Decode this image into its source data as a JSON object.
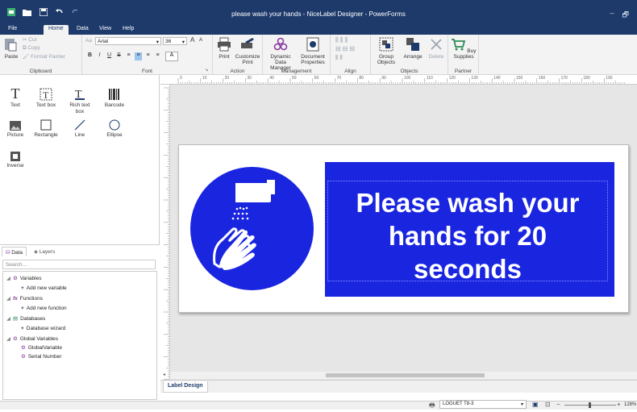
{
  "window": {
    "title": "please wash your hands - NiceLabel Designer - PowerForms",
    "minimize": "–",
    "maximize": "🗗"
  },
  "menu_tabs": [
    "File",
    "Home",
    "Data",
    "View",
    "Help"
  ],
  "ribbon": {
    "clipboard": {
      "paste": "Paste",
      "cut": "Cut",
      "copy": "Copy",
      "format_painter": "Format Painter",
      "label": "Clipboard"
    },
    "font": {
      "family": "Arial",
      "size": "36",
      "grow": "A",
      "shrink": "A",
      "color_letter": "A",
      "label": "Font"
    },
    "action": {
      "print": "Print",
      "customize_print": "Customize Print",
      "label": "Action"
    },
    "management": {
      "dynamic_data_manager": "Dynamic Data Manager",
      "document_properties": "Document Properties",
      "label": "Management"
    },
    "align": {
      "label": "Align"
    },
    "objects": {
      "group_objects": "Group Objects",
      "arrange": "Arrange",
      "delete": "Delete",
      "label": "Objects"
    },
    "partner": {
      "buy_supplies": "Buy Supplies",
      "label": "Partner"
    }
  },
  "toolbox": {
    "text": "Text",
    "text_box": "Text box",
    "rich_text_box": "Rich text box",
    "barcode": "Barcode",
    "picture": "Picture",
    "rectangle": "Rectangle",
    "line": "Line",
    "ellipse": "Ellipse",
    "inverse": "Inverse"
  },
  "data_panel": {
    "tabs": [
      "Data",
      "Layers"
    ],
    "search_placeholder": "Search...",
    "tree": {
      "variables": "Variables",
      "add_variable": "Add new variable",
      "functions": "Functions",
      "add_function": "Add new function",
      "databases": "Databases",
      "database_wizard": "Database wizard",
      "global_variables": "Global Variables",
      "global_variable": "GlobalVariable",
      "serial_number": "Serial Number"
    }
  },
  "ruler_labels": [
    "0",
    "10",
    "20",
    "30",
    "40",
    "50",
    "60",
    "70",
    "80",
    "90",
    "100",
    "110",
    "120",
    "130",
    "140",
    "150",
    "160",
    "170",
    "180",
    "190"
  ],
  "label": {
    "line1": "Please wash your",
    "line2": "hands for 20",
    "line3": "seconds",
    "sign_color": "#1a25e0"
  },
  "bottom_tab": "Label Design",
  "status": {
    "printer": "LOGUET T8-3",
    "zoom": "128%"
  },
  "colors": {
    "titlebar": "#1d3a6b",
    "ribbon": "#f3f3f3"
  }
}
